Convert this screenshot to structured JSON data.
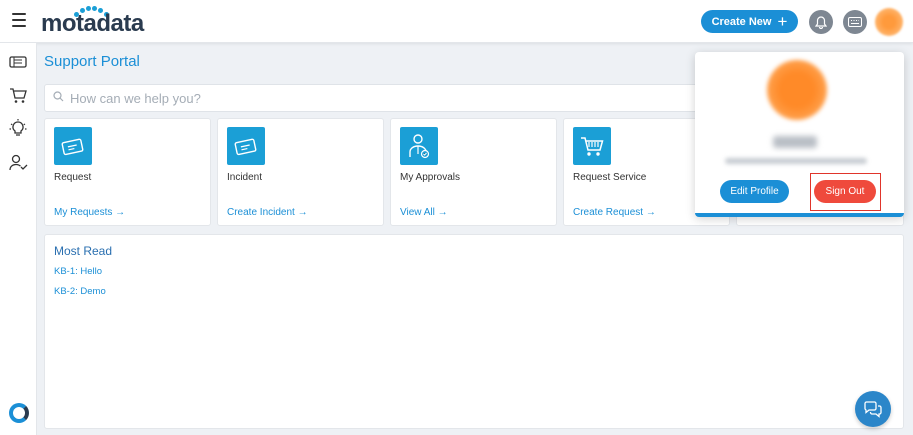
{
  "header": {
    "brand": "motadata",
    "create_label": "Create New",
    "create_icon": "+"
  },
  "portal": {
    "title": "Support Portal",
    "search_placeholder": "How can we help you?"
  },
  "cards": [
    {
      "title": "Request",
      "link": "My Requests →",
      "icon": "ticket-icon"
    },
    {
      "title": "Incident",
      "link": "Create Incident →",
      "icon": "incident-ticket-icon"
    },
    {
      "title": "My Approvals",
      "link": "View All →",
      "icon": "approver-icon"
    },
    {
      "title": "Request Service",
      "link": "Create Request →",
      "icon": "shopping-cart-icon"
    }
  ],
  "most_read": {
    "heading": "Most Read",
    "items": [
      "KB-1: Hello",
      "KB-2: Demo"
    ]
  },
  "profile_menu": {
    "edit_label": "Edit Profile",
    "signout_label": "Sign Out"
  },
  "colors": {
    "accent": "#1b8fd6",
    "tile": "#1b9fd6",
    "danger": "#ef4a3c"
  }
}
